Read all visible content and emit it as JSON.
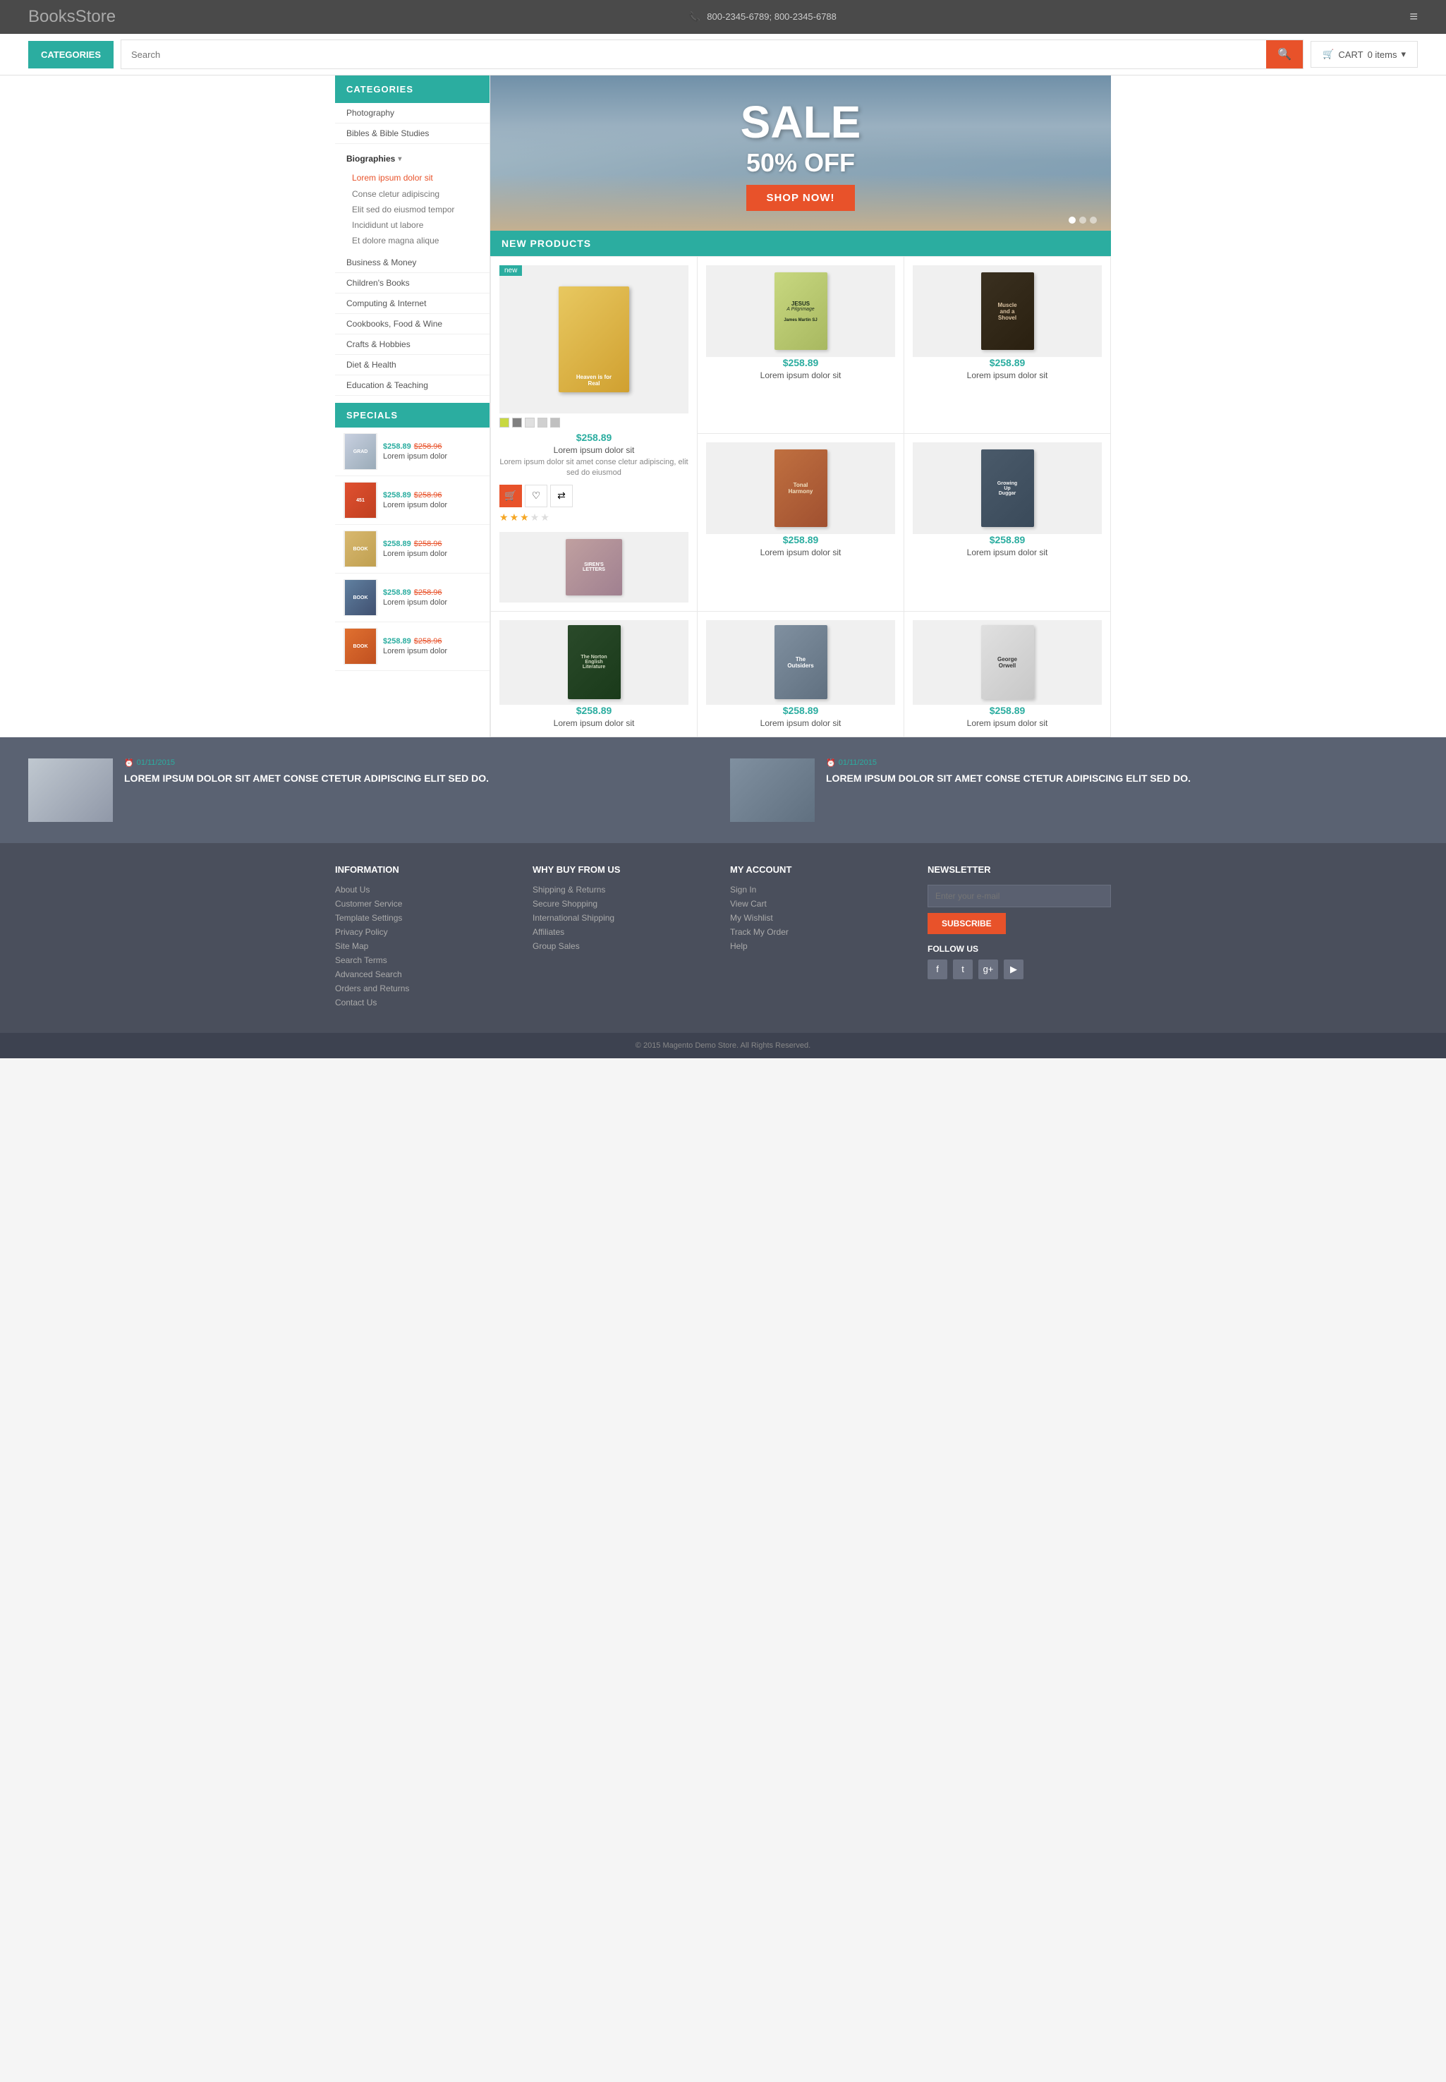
{
  "header": {
    "logo_books": "Books",
    "logo_store": "Store",
    "phone": "800-2345-6789; 800-2345-6788",
    "categories_label": "CATEGORIES",
    "search_placeholder": "Search",
    "cart_label": "CART",
    "cart_items": "0 items"
  },
  "sidebar": {
    "categories": [
      {
        "label": "Photography",
        "level": 0
      },
      {
        "label": "Bibles & Bible Studies",
        "level": 0
      },
      {
        "label": "Biographies",
        "level": 1
      },
      {
        "label": "Lorem ipsum dolor sit",
        "level": 2,
        "active": true
      },
      {
        "label": "Conse cletur adipiscing",
        "level": 3
      },
      {
        "label": "Elit sed do eiusmod tempor",
        "level": 3
      },
      {
        "label": "Incididunt ut labore",
        "level": 3
      },
      {
        "label": "Et dolore magna alique",
        "level": 3
      },
      {
        "label": "Business & Money",
        "level": 0
      },
      {
        "label": "Children's Books",
        "level": 0
      },
      {
        "label": "Computing & Internet",
        "level": 0
      },
      {
        "label": "Cookbooks, Food & Wine",
        "level": 0
      },
      {
        "label": "Crafts & Hobbies",
        "level": 0
      },
      {
        "label": "Diet & Health",
        "level": 0
      },
      {
        "label": "Education & Teaching",
        "level": 0
      }
    ],
    "specials_label": "SPECIALS",
    "specials": [
      {
        "price_new": "$258.89",
        "price_old": "$258.96",
        "name": "Lorem ipsum dolor"
      },
      {
        "price_new": "$258.89",
        "price_old": "$258.96",
        "name": "Lorem ipsum dolor"
      },
      {
        "price_new": "$258.89",
        "price_old": "$258.96",
        "name": "Lorem ipsum dolor"
      },
      {
        "price_new": "$258.89",
        "price_old": "$258.96",
        "name": "Lorem ipsum dolor"
      },
      {
        "price_new": "$258.89",
        "price_old": "$258.96",
        "name": "Lorem ipsum dolor"
      }
    ]
  },
  "hero": {
    "sale_text": "SALE",
    "off_text": "50% OFF",
    "button_label": "SHOP NOW!"
  },
  "new_products": {
    "section_title": "NEW PRODUCTS",
    "featured": {
      "badge": "new",
      "price": "$258.89",
      "name": "Lorem ipsum dolor sit",
      "desc": "Lorem ipsum dolor sit amet conse cletur adipiscing, elit sed do eiusmod",
      "stars": 3
    },
    "products": [
      {
        "price": "$258.89",
        "name": "Lorem ipsum dolor sit",
        "book_color": "#c8d87a",
        "book_title": "JESUS\nA Pilgrimage\nJames Martin SJ"
      },
      {
        "price": "$258.89",
        "name": "Lorem ipsum dolor sit",
        "book_color": "#2a2a1a",
        "book_title": "Muscle and a Shovel"
      },
      {
        "price": "$258.89",
        "name": "Lorem ipsum dolor sit",
        "book_color": "#d4a060",
        "book_title": "Tonal Harmony"
      },
      {
        "price": "$258.89",
        "name": "Lorem ipsum dolor sit",
        "book_color": "#5a6070",
        "book_title": "Growing Up Duggar Hollywood"
      },
      {
        "price": "$258.89",
        "name": "Lorem ipsum dolor sit",
        "book_color": "#2a4a2a",
        "book_title": "The Norton English Literature"
      },
      {
        "price": "$258.89",
        "name": "Lorem ipsum dolor sit",
        "book_color": "#8a9aaa",
        "book_title": "The Outsiders"
      },
      {
        "price": "$258.89",
        "name": "Lorem ipsum dolor sit",
        "book_color": "#e8e8e8",
        "book_title": "George Orwell"
      }
    ]
  },
  "blog": {
    "items": [
      {
        "date": "01/11/2015",
        "title": "LOREM IPSUM DOLOR SIT AMET CONSE CTETUR ADIPISCING ELIT SED DO."
      },
      {
        "date": "01/11/2015",
        "title": "LOREM IPSUM DOLOR SIT AMET CONSE CTETUR ADIPISCING ELIT SED DO."
      }
    ]
  },
  "footer": {
    "information": {
      "title": "INFORMATION",
      "links": [
        "About Us",
        "Customer Service",
        "Template Settings",
        "Privacy Policy",
        "Site Map",
        "Search Terms",
        "Advanced Search",
        "Orders and Returns",
        "Contact Us"
      ]
    },
    "why_buy": {
      "title": "WHY BUY FROM US",
      "links": [
        "Shipping & Returns",
        "Secure Shopping",
        "International Shipping",
        "Affiliates",
        "Group Sales"
      ]
    },
    "my_account": {
      "title": "MY ACCOUNT",
      "links": [
        "Sign In",
        "View Cart",
        "My Wishlist",
        "Track My Order",
        "Help"
      ]
    },
    "newsletter": {
      "title": "NEWSLETTER",
      "placeholder": "Enter your e-mail",
      "button_label": "SUBSCRIBE",
      "follow_label": "FOLLOW US"
    },
    "copyright": "© 2015 Magento Demo Store. All Rights Reserved."
  }
}
